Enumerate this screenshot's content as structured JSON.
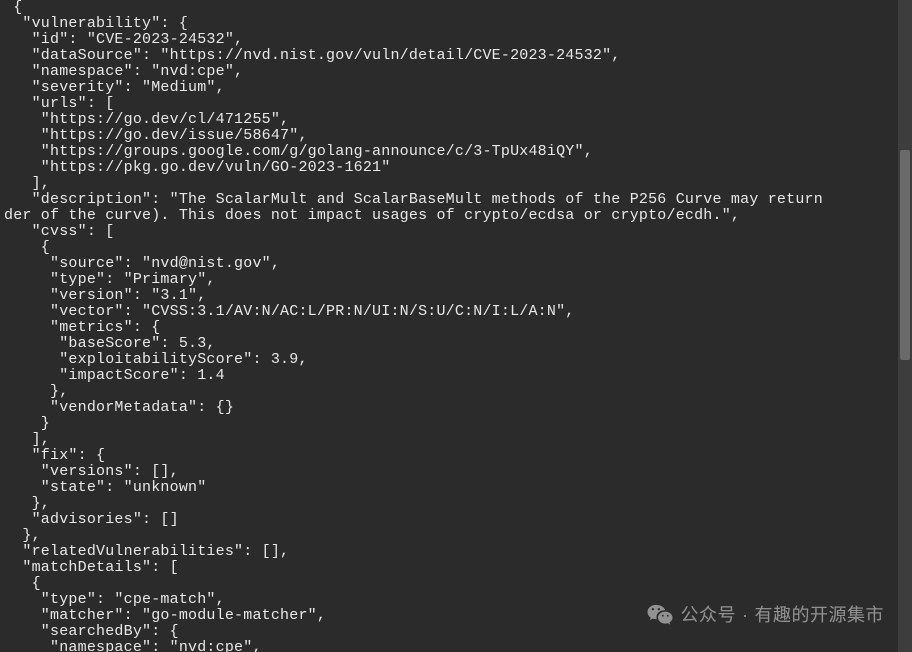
{
  "lines": [
    " {",
    "  \"vulnerability\": {",
    "   \"id\": \"CVE-2023-24532\",",
    "   \"dataSource\": \"https://nvd.nist.gov/vuln/detail/CVE-2023-24532\",",
    "   \"namespace\": \"nvd:cpe\",",
    "   \"severity\": \"Medium\",",
    "   \"urls\": [",
    "    \"https://go.dev/cl/471255\",",
    "    \"https://go.dev/issue/58647\",",
    "    \"https://groups.google.com/g/golang-announce/c/3-TpUx48iQY\",",
    "    \"https://pkg.go.dev/vuln/GO-2023-1621\"",
    "   ],",
    "   \"description\": \"The ScalarMult and ScalarBaseMult methods of the P256 Curve may return",
    "der of the curve). This does not impact usages of crypto/ecdsa or crypto/ecdh.\",",
    "   \"cvss\": [",
    "    {",
    "     \"source\": \"nvd@nist.gov\",",
    "     \"type\": \"Primary\",",
    "     \"version\": \"3.1\",",
    "     \"vector\": \"CVSS:3.1/AV:N/AC:L/PR:N/UI:N/S:U/C:N/I:L/A:N\",",
    "     \"metrics\": {",
    "      \"baseScore\": 5.3,",
    "      \"exploitabilityScore\": 3.9,",
    "      \"impactScore\": 1.4",
    "     },",
    "     \"vendorMetadata\": {}",
    "    }",
    "   ],",
    "   \"fix\": {",
    "    \"versions\": [],",
    "    \"state\": \"unknown\"",
    "   },",
    "   \"advisories\": []",
    "  },",
    "  \"relatedVulnerabilities\": [],",
    "  \"matchDetails\": [",
    "   {",
    "    \"type\": \"cpe-match\",",
    "    \"matcher\": \"go-module-matcher\",",
    "    \"searchedBy\": {",
    "     \"namespace\": \"nvd:cpe\","
  ],
  "watermark": {
    "prefix": "公众号",
    "dot": "·",
    "name": "有趣的开源集市"
  }
}
